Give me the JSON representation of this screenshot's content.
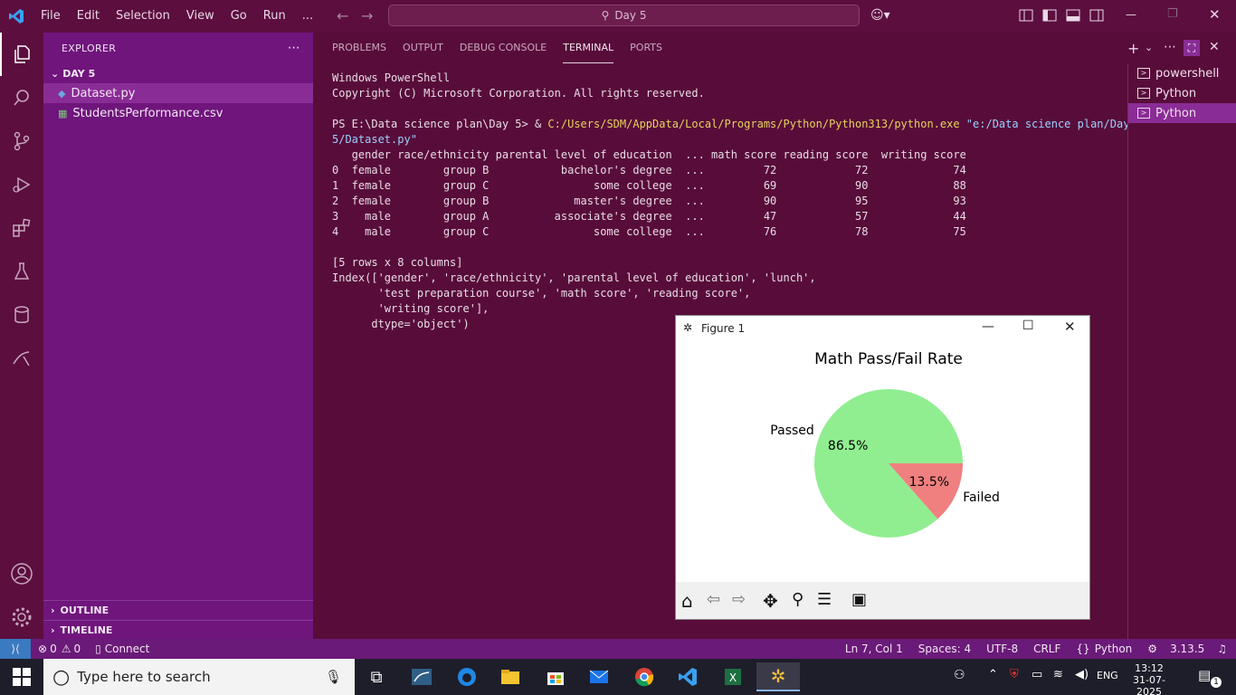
{
  "titlebar": {
    "menu": [
      "File",
      "Edit",
      "Selection",
      "View",
      "Go",
      "Run",
      "..."
    ],
    "search_text": "Day 5"
  },
  "sidebar": {
    "header": "EXPLORER",
    "folder": "DAY 5",
    "files": [
      {
        "name": "Dataset.py",
        "icon": "python-file-icon",
        "selected": true
      },
      {
        "name": "StudentsPerformance.csv",
        "icon": "csv-file-icon",
        "selected": false
      }
    ],
    "outline": "OUTLINE",
    "timeline": "TIMELINE"
  },
  "panel": {
    "tabs": [
      "PROBLEMS",
      "OUTPUT",
      "DEBUG CONSOLE",
      "TERMINAL",
      "PORTS"
    ],
    "active_tab": "TERMINAL",
    "terminal": {
      "line1": "Windows PowerShell",
      "line2": "Copyright (C) Microsoft Corporation. All rights reserved.",
      "prompt": "PS E:\\Data science plan\\Day 5> & ",
      "exe": "C:/Users/SDM/AppData/Local/Programs/Python/Python313/python.exe",
      "arg1": " \"e:/Data science plan/Day",
      "arg2": "5/Dataset.py\"",
      "table_header": "   gender race/ethnicity parental level of education  ... math score reading score  writing score",
      "rows": [
        "0  female        group B           bachelor's degree  ...         72            72             74",
        "1  female        group C                some college  ...         69            90             88",
        "2  female        group B             master's degree  ...         90            95             93",
        "3    male        group A          associate's degree  ...         47            57             44",
        "4    male        group C                some college  ...         76            78             75"
      ],
      "rows_info": "[5 rows x 8 columns]",
      "index1": "Index(['gender', 'race/ethnicity', 'parental level of education', 'lunch',",
      "index2": "       'test preparation course', 'math score', 'reading score',",
      "index3": "       'writing score'],",
      "index4": "      dtype='object')"
    },
    "terminal_list": [
      {
        "label": "powershell",
        "selected": false
      },
      {
        "label": "Python",
        "selected": false
      },
      {
        "label": "Python",
        "selected": true
      }
    ]
  },
  "figure": {
    "window_title": "Figure 1",
    "chart_data": {
      "type": "pie",
      "title": "Math Pass/Fail Rate",
      "labels": [
        "Passed",
        "Failed"
      ],
      "values": [
        86.5,
        13.5
      ],
      "value_labels": [
        "86.5%",
        "13.5%"
      ],
      "colors": [
        "#90ee90",
        "#f08080"
      ]
    },
    "toolbar_icons": [
      "home-icon",
      "back-icon",
      "forward-icon",
      "pan-icon",
      "zoom-icon",
      "configure-icon",
      "save-icon"
    ]
  },
  "statusbar": {
    "errors": "0",
    "warnings": "0",
    "connect": "Connect",
    "position": "Ln 7, Col 1",
    "spaces": "Spaces: 4",
    "encoding": "UTF-8",
    "eol": "CRLF",
    "language": "Python",
    "python_version": "3.13.5"
  },
  "taskbar": {
    "search_placeholder": "Type here to search",
    "language": "ENG",
    "time": "13:12",
    "date": "31-07-2025",
    "notifications": "1"
  },
  "colors": {
    "accent": "#6f157c",
    "background": "#580c3a",
    "status": "#6a1a78"
  }
}
